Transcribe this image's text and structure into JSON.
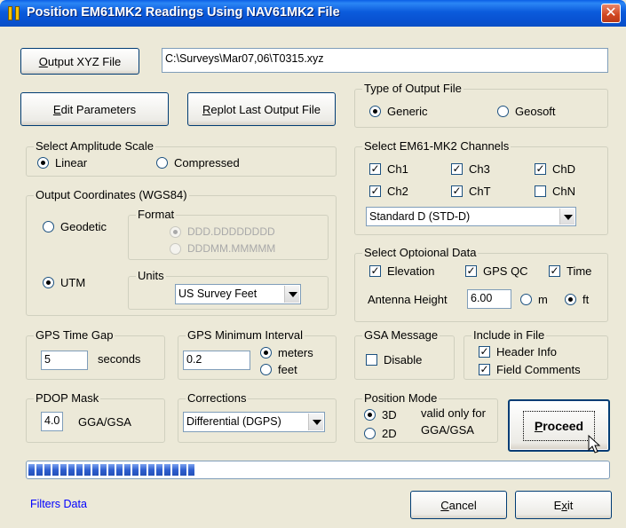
{
  "window": {
    "title": "Position EM61MK2 Readings Using NAV61MK2 File",
    "close_glyph": "✕"
  },
  "output_file": {
    "button_accesskey": "O",
    "button_rest": "utput XYZ File",
    "path": "C:\\Surveys\\Mar07,06\\T0315.xyz"
  },
  "buttons": {
    "edit_key": "E",
    "edit_rest": "dit Parameters",
    "replot_key": "R",
    "replot_rest": "eplot Last Output File",
    "proceed_key": "P",
    "proceed_rest": "roceed",
    "cancel_key": "C",
    "cancel_rest": "ancel",
    "exit_pre": "E",
    "exit_key": "x",
    "exit_rest": "it"
  },
  "output_type": {
    "legend": "Type of Output File",
    "generic": "Generic",
    "geosoft": "Geosoft",
    "selected": "generic"
  },
  "amplitude": {
    "legend": "Select Amplitude Scale",
    "linear": "Linear",
    "compressed": "Compressed",
    "selected": "linear"
  },
  "channels": {
    "legend": "Select EM61-MK2 Channels",
    "items": [
      {
        "label": "Ch1",
        "checked": true
      },
      {
        "label": "Ch3",
        "checked": true
      },
      {
        "label": "ChD",
        "checked": true
      },
      {
        "label": "Ch2",
        "checked": true
      },
      {
        "label": "ChT",
        "checked": true
      },
      {
        "label": "ChN",
        "checked": false
      }
    ],
    "mode_value": "Standard D  (STD-D)"
  },
  "coords": {
    "legend": "Output Coordinates (WGS84)",
    "geodetic": "Geodetic",
    "utm": "UTM",
    "selected": "utm",
    "format_legend": "Format",
    "format_opt1": "DDD.DDDDDDDD",
    "format_opt2": "DDDMM.MMMMM",
    "units_legend": "Units",
    "units_value": "US Survey Feet"
  },
  "optional": {
    "legend": "Select Optoional Data",
    "elevation": "Elevation",
    "gpsqc": "GPS QC",
    "time": "Time",
    "antenna_label": "Antenna Height",
    "antenna_value": "6.00",
    "m": "m",
    "ft": "ft",
    "unit_selected": "ft"
  },
  "gps_gap": {
    "legend": "GPS Time Gap",
    "value": "5",
    "unit": "seconds"
  },
  "gps_interval": {
    "legend": "GPS Minimum Interval",
    "value": "0.2",
    "meters": "meters",
    "feet": "feet",
    "selected": "meters"
  },
  "gsa": {
    "legend": "GSA Message",
    "disable": "Disable",
    "checked": false
  },
  "include": {
    "legend": "Include in File",
    "header": "Header Info",
    "comments": "Field Comments"
  },
  "pdop": {
    "legend": "PDOP Mask",
    "value": "4.0",
    "unit": "GGA/GSA"
  },
  "corrections": {
    "legend": "Corrections",
    "value": "Differential (DGPS)"
  },
  "position_mode": {
    "legend": "Position Mode",
    "d3": "3D",
    "d2": "2D",
    "selected": "3D",
    "note_line1": "valid only for",
    "note_line2": "GGA/GSA"
  },
  "progress": {
    "fraction": 0.29
  },
  "status": {
    "text": "Filters Data"
  }
}
